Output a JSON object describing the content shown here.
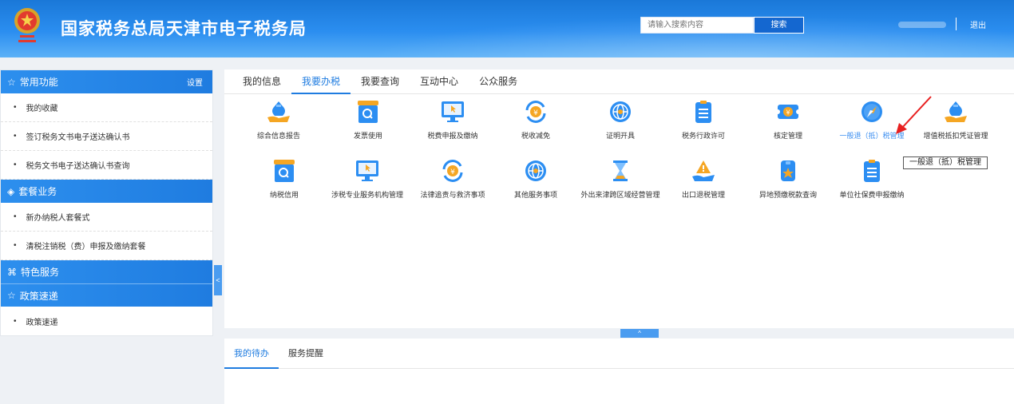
{
  "header": {
    "title": "国家税务总局天津市电子税务局",
    "search_placeholder": "请输入搜索内容",
    "search_label": "搜索",
    "logout_label": "退出"
  },
  "sidebar": {
    "common": {
      "title": "常用功能",
      "settings": "设置",
      "items": [
        "我的收藏",
        "签订税务文书电子送达确认书",
        "税务文书电子送达确认书查询"
      ]
    },
    "package": {
      "title": "套餐业务",
      "items": [
        "新办纳税人套餐式",
        "清税注销税（费）申报及缴纳套餐"
      ]
    },
    "special": {
      "title": "特色服务"
    },
    "policy": {
      "title": "政策速递",
      "items": [
        "政策速递"
      ]
    },
    "collapse": "<"
  },
  "main": {
    "tabs": [
      "我的信息",
      "我要办税",
      "我要查询",
      "互动中心",
      "公众服务"
    ],
    "active_tab": "我要办税",
    "services": [
      {
        "label": "综合信息报告",
        "icon": "hand-moneybag-icon"
      },
      {
        "label": "发票使用",
        "icon": "invoice-search-icon"
      },
      {
        "label": "税费申报及缴纳",
        "icon": "monitor-cursor-icon"
      },
      {
        "label": "税收减免",
        "icon": "yuan-refresh-icon"
      },
      {
        "label": "证明开具",
        "icon": "globe-certificate-icon"
      },
      {
        "label": "税务行政许可",
        "icon": "clipboard-icon"
      },
      {
        "label": "核定管理",
        "icon": "yuan-ticket-icon"
      },
      {
        "label": "一般退（抵）税管理",
        "icon": "compass-icon"
      },
      {
        "label": "增值税抵扣凭证管理",
        "icon": "hand-moneybag-icon"
      },
      {
        "label": "纳税信用",
        "icon": "invoice-search-icon"
      },
      {
        "label": "涉税专业服务机构管理",
        "icon": "monitor-cursor-icon"
      },
      {
        "label": "法律追责与救济事项",
        "icon": "yuan-refresh-icon"
      },
      {
        "label": "其他服务事项",
        "icon": "globe-icon"
      },
      {
        "label": "外出来津跨区域经营管理",
        "icon": "hourglass-icon"
      },
      {
        "label": "出口退税管理",
        "icon": "hand-warning-icon"
      },
      {
        "label": "异地预缴税款查询",
        "icon": "star-badge-icon"
      },
      {
        "label": "单位社保费申报缴纳",
        "icon": "clipboard-icon"
      }
    ],
    "tooltip": "一般退（抵）税管理",
    "expand": "^"
  },
  "bottom": {
    "tabs": [
      "我的待办",
      "服务提醒"
    ],
    "active_tab": "我的待办"
  },
  "colors": {
    "primary": "#1f7ce0",
    "header": "#2b8ef0",
    "accent_arrow": "#e82020",
    "icon_orange": "#f5a623"
  }
}
